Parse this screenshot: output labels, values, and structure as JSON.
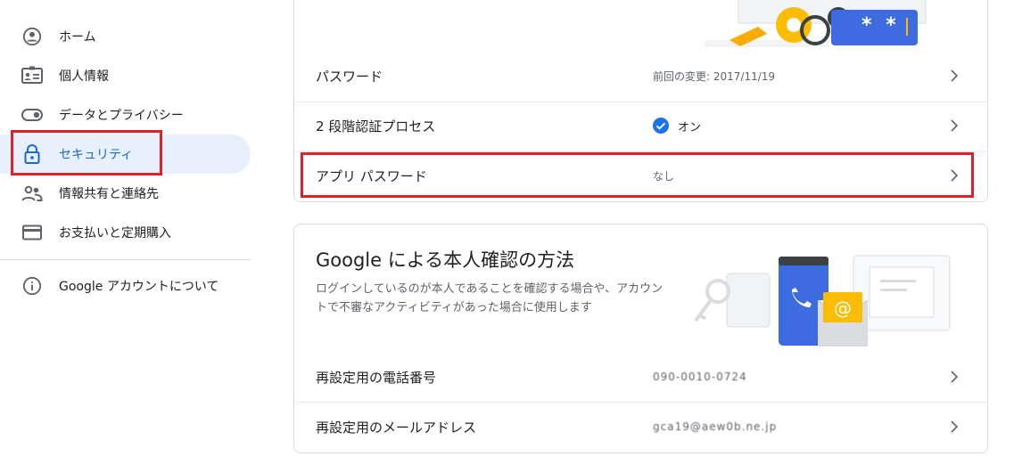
{
  "sidebar": {
    "items": [
      {
        "label": "ホーム",
        "icon": "account-circle-icon"
      },
      {
        "label": "個人情報",
        "icon": "id-card-icon"
      },
      {
        "label": "データとプライバシー",
        "icon": "toggle-icon"
      },
      {
        "label": "セキュリティ",
        "icon": "lock-icon",
        "active": true
      },
      {
        "label": "情報共有と連絡先",
        "icon": "people-icon"
      },
      {
        "label": "お支払いと定期購入",
        "icon": "credit-card-icon"
      }
    ],
    "footer": {
      "label": "Google アカウントについて",
      "icon": "info-icon"
    }
  },
  "security_card": {
    "illustration_text": "* *",
    "rows": [
      {
        "label": "パスワード",
        "value": "前回の変更: 2017/11/19"
      },
      {
        "label": "2 段階認証プロセス",
        "value": "オン"
      },
      {
        "label": "アプリ パスワード",
        "value": "なし"
      }
    ]
  },
  "verify_card": {
    "title": "Google による本人確認の方法",
    "description": "ログインしているのが本人であることを確認する場合や、アカウントで不審なアクティビティがあった場合に使用します",
    "rows": [
      {
        "label": "再設定用の電話番号",
        "value": "090-0010-0724"
      },
      {
        "label": "再設定用のメールアドレス",
        "value": "gca19@aew0b.ne.jp"
      }
    ]
  },
  "colors": {
    "accent": "#1a73e8",
    "active_bg": "#e8f0fe",
    "highlight": "#e0202a"
  }
}
